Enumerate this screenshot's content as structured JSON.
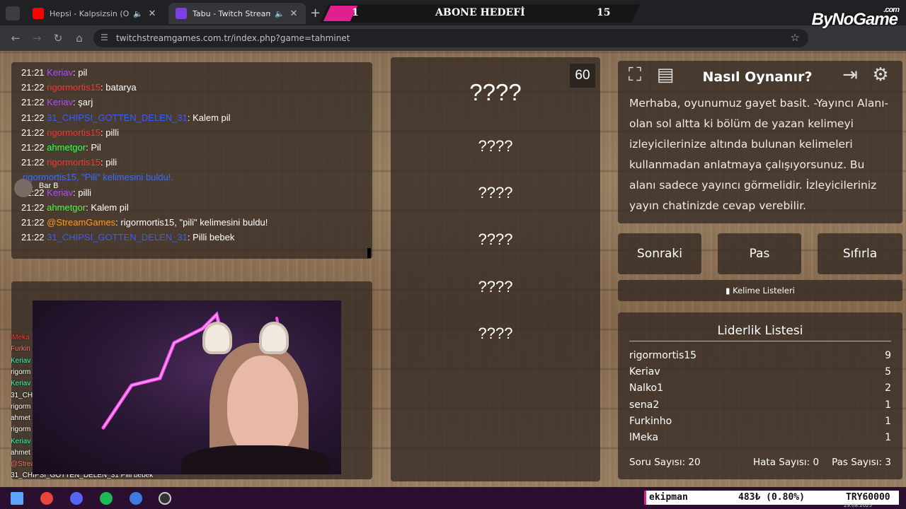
{
  "browser": {
    "tabs": [
      {
        "title": "Hepsi - Kalpsizsin (Official V",
        "active": false
      },
      {
        "title": "Tabu - Twitch Stream Game",
        "active": true
      }
    ],
    "url": "twitchstreamgames.com.tr/index.php?game=tahminet"
  },
  "abone": {
    "left": "1",
    "label": "ABONE HEDEFİ",
    "right": "15"
  },
  "logo": {
    "text": "ByNoGame",
    "suffix": ".com"
  },
  "chat": [
    {
      "time": "21:21",
      "user": "Keriav",
      "color": "#b04cff",
      "msg": ": pil"
    },
    {
      "time": "21:22",
      "user": "rigormortis15",
      "color": "#ff3030",
      "msg": ": batarya"
    },
    {
      "time": "21:22",
      "user": "Keriav",
      "color": "#b04cff",
      "msg": ": şarj"
    },
    {
      "time": "21:22",
      "user": "31_CHIPSI_GOTTEN_DELEN_31",
      "color": "#3a5bff",
      "msg": ": Kalem pil"
    },
    {
      "time": "21:22",
      "user": "rigormortis15",
      "color": "#ff3030",
      "msg": ": pilli"
    },
    {
      "time": "21:22",
      "user": "ahmetgor",
      "color": "#3dff45",
      "msg": ": Pil"
    },
    {
      "time": "21:22",
      "user": "rigormortis15",
      "color": "#ff3030",
      "msg": ": pili"
    },
    {
      "time": "",
      "user": "rigormortis15, \"Pili\" kelimesini buldu!.",
      "color": "#3a6cff",
      "msg": ""
    },
    {
      "time": "21:22",
      "user": "Keriav",
      "color": "#b04cff",
      "msg": ": pilli"
    },
    {
      "time": "21:22",
      "user": "ahmetgor",
      "color": "#3dff45",
      "msg": ": Kalem pil"
    },
    {
      "time": "21:22",
      "user": "@StreamGames",
      "color": "#ff9a2a",
      "msg": ": rigormortis15, \"pili\" kelimesini buldu!"
    },
    {
      "time": "21:22",
      "user": "31_CHIPSI_GOTTEN_DELEN_31",
      "color": "#3a5bff",
      "msg": ": Pilli bebek"
    }
  ],
  "chat_popup_name": "Bar B",
  "words": {
    "main": "????",
    "forbidden": [
      "????",
      "????",
      "????",
      "????",
      "????"
    ]
  },
  "timer": "60",
  "howto": {
    "title": "Nasıl Oynanır?",
    "text": "Merhaba, oyunumuz gayet basit. -Yayıncı Alanı- olan sol altta ki bölüm de yazan kelimeyi izleyicilerinize altında bulunan kelimeleri kullanmadan anlatmaya çalışıyorsunuz. Bu alanı sadece yayıncı görmelidir. İzleyicileriniz yayın chatinizde cevap verebilir."
  },
  "controls": {
    "next": "Sonraki",
    "pass": "Pas",
    "reset": "Sıfırla",
    "wordlists": "Kelime Listeleri"
  },
  "leaderboard": {
    "title": "Liderlik Listesi",
    "rows": [
      {
        "name": "rigormortis15",
        "score": "9"
      },
      {
        "name": "Keriav",
        "score": "5"
      },
      {
        "name": "Nalko1",
        "score": "2"
      },
      {
        "name": "sena2",
        "score": "1"
      },
      {
        "name": "Furkinho",
        "score": "1"
      },
      {
        "name": "lMeka",
        "score": "1"
      }
    ]
  },
  "stats": {
    "questions": "Soru Sayısı: 20",
    "errors": "Hata Sayısı: 0",
    "passes": "Pas Sayısı: 3"
  },
  "overlay_names": [
    {
      "name": "lMeka",
      "color": "#ff3b3b"
    },
    {
      "name": "Furkin",
      "color": "#ff7676"
    },
    {
      "name": "Keriav",
      "color": "#3dffc0"
    },
    {
      "name": "rigorm",
      "color": "#ffffff"
    },
    {
      "name": "Keriav",
      "color": "#3dffc0"
    },
    {
      "name": "31_CH",
      "color": "#ffffff"
    },
    {
      "name": "rigorm",
      "color": "#ffffff"
    },
    {
      "name": "ahmet",
      "color": "#ffffff"
    },
    {
      "name": "rigorm",
      "color": "#ffffff"
    },
    {
      "name": "Keriav",
      "color": "#3dffc0"
    },
    {
      "name": "ahmet",
      "color": "#ffffff"
    },
    {
      "name": "@Strea",
      "color": "#ff7676"
    }
  ],
  "overlay_last": "31_CHIPSI_GOTTEN_DELEN_31  Pilli bebek",
  "ticker": {
    "name": "ekipman",
    "amount": "483₺ (0.80%)",
    "goal": "TRY60000"
  },
  "date": "29.08.2025"
}
